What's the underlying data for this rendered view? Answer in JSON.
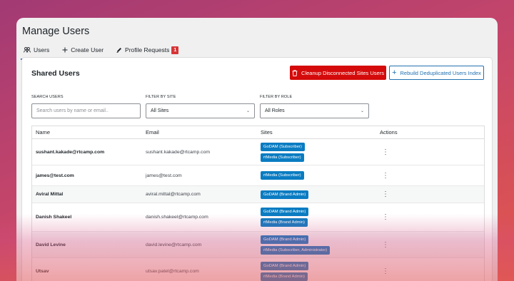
{
  "page_title": "Manage Users",
  "tabs": [
    {
      "label": "Users",
      "icon": "users-icon"
    },
    {
      "label": "Create User",
      "icon": "plus-icon"
    },
    {
      "label": "Profile Requests",
      "icon": "pencil-icon",
      "badge": "1"
    }
  ],
  "card": {
    "title": "Shared Users",
    "cleanup_button": "Cleanup Disconnected Sites Users",
    "rebuild_button": "Rebuild Deduplicated Users Index"
  },
  "filters": {
    "search_label": "SEARCH USERS",
    "search_placeholder": "Search users by name or email..",
    "site_label": "FILTER BY SITE",
    "site_value": "All Sites",
    "role_label": "FILTER BY ROLE",
    "role_value": "All Roles"
  },
  "table": {
    "headers": [
      "Name",
      "Email",
      "Sites",
      "Actions"
    ],
    "rows": [
      {
        "name": "sushant.kakade@rtcamp.com",
        "email": "sushant.kakade@rtcamp.com",
        "sites": [
          "GoDAM (Subscriber)",
          "rtMedia (Subscriber)"
        ]
      },
      {
        "name": "james@test.com",
        "email": "james@test.com",
        "sites": [
          "rtMedia (Subscriber)"
        ]
      },
      {
        "name": "Aviral Mittal",
        "email": "aviral.mittal@rtcamp.com",
        "sites": [
          "GoDAM (Brand Admin)"
        ]
      },
      {
        "name": "Danish Shakeel",
        "email": "danish.shakeel@rtcamp.com",
        "sites": [
          "GoDAM (Brand Admin)",
          "rtMedia (Brand Admin)"
        ]
      },
      {
        "name": "David Levine",
        "email": "david.levine@rtcamp.com",
        "sites": [
          "GoDAM (Brand Admin)",
          "rtMedia (Subscriber, Administrator)"
        ]
      },
      {
        "name": "Utsav",
        "email": "utsav.patel@rtcamp.com",
        "sites": [
          "GoDAM (Brand Admin)",
          "rtMedia (Brand Admin)"
        ]
      }
    ],
    "action_glyph": "⋮"
  },
  "colors": {
    "accent": "#2271b1",
    "danger": "#d50a0a",
    "site_pill": "#0a7cc2"
  }
}
